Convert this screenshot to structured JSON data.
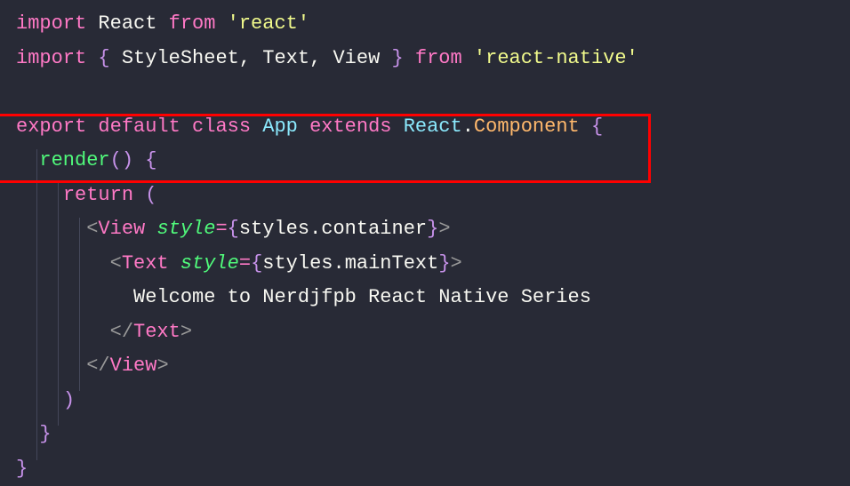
{
  "code": {
    "line1": {
      "import": "import",
      "react": "React",
      "from": "from",
      "reactStr": "'react'"
    },
    "line2": {
      "import": "import",
      "lbrace": "{",
      "stylesheet": "StyleSheet",
      "comma1": ",",
      "text": "Text",
      "comma2": ",",
      "view": "View",
      "rbrace": "}",
      "from": "from",
      "reactNativeStr": "'react-native'"
    },
    "line4": {
      "export": "export",
      "default": "default",
      "class": "class",
      "app": "App",
      "extends": "extends",
      "react": "React",
      "dot": ".",
      "component": "Component",
      "lbrace": "{"
    },
    "line5": {
      "render": "render",
      "parens": "()",
      "lbrace": "{"
    },
    "line6": {
      "return": "return",
      "lparen": "("
    },
    "line7": {
      "lt": "<",
      "view": "View",
      "style": "style",
      "eq": "=",
      "lbrace": "{",
      "styles": "styles",
      "dot": ".",
      "container": "container",
      "rbrace": "}",
      "gt": ">"
    },
    "line8": {
      "lt": "<",
      "text": "Text",
      "style": "style",
      "eq": "=",
      "lbrace": "{",
      "styles": "styles",
      "dot": ".",
      "maintext": "mainText",
      "rbrace": "}",
      "gt": ">"
    },
    "line9": {
      "content": "Welcome to Nerdjfpb React Native Series"
    },
    "line10": {
      "ltslash": "</",
      "text": "Text",
      "gt": ">"
    },
    "line11": {
      "ltslash": "</",
      "view": "View",
      "gt": ">"
    },
    "line12": {
      "rparen": ")"
    },
    "line13": {
      "rbrace": "}"
    },
    "line14": {
      "rbrace": "}"
    }
  },
  "colors": {
    "background": "#282a36",
    "highlight": "#ff0000"
  }
}
